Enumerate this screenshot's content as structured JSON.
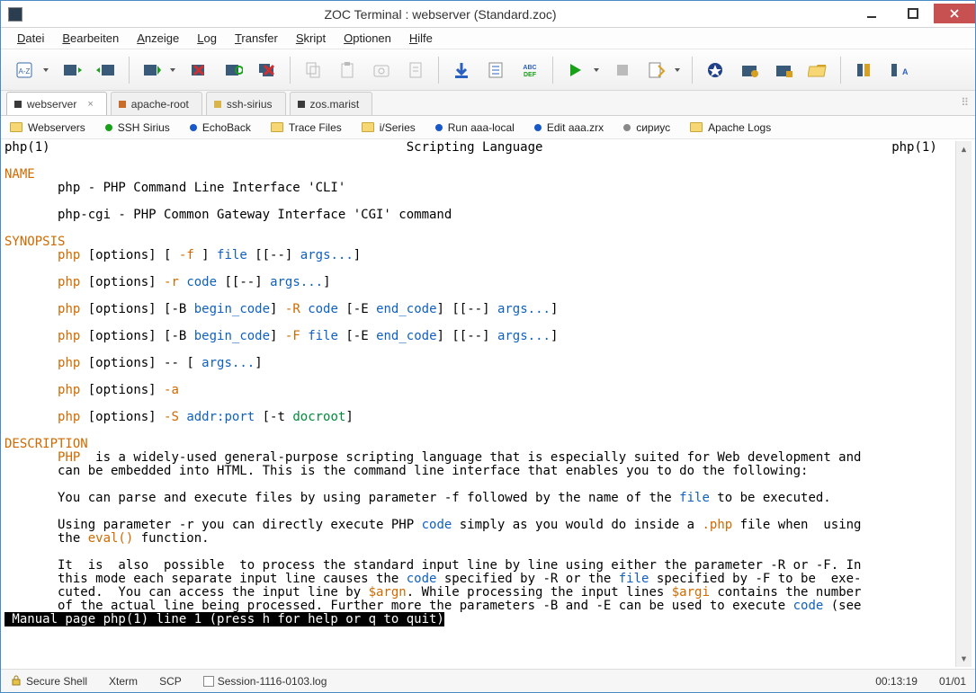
{
  "window": {
    "title": "ZOC Terminal : webserver (Standard.zoc)"
  },
  "menu": [
    "Datei",
    "Bearbeiten",
    "Anzeige",
    "Log",
    "Transfer",
    "Skript",
    "Optionen",
    "Hilfe"
  ],
  "toolbar_groups": [
    {
      "items": [
        {
          "name": "address-book",
          "drop": true
        },
        {
          "name": "session-prev"
        },
        {
          "name": "session-next"
        }
      ]
    },
    {
      "items": [
        {
          "name": "connect",
          "drop": true
        },
        {
          "name": "disconnect"
        },
        {
          "name": "reconnect"
        },
        {
          "name": "disconnect-all"
        }
      ]
    },
    {
      "items": [
        {
          "name": "copy",
          "dim": true
        },
        {
          "name": "paste",
          "dim": true
        },
        {
          "name": "capture",
          "dim": true
        },
        {
          "name": "clipboard",
          "dim": true
        }
      ]
    },
    {
      "items": [
        {
          "name": "download"
        },
        {
          "name": "notes"
        },
        {
          "name": "abc-def"
        }
      ]
    },
    {
      "items": [
        {
          "name": "run",
          "drop": true
        },
        {
          "name": "stop",
          "dim": true
        },
        {
          "name": "script-edit",
          "drop": true
        }
      ]
    },
    {
      "items": [
        {
          "name": "tool-a"
        },
        {
          "name": "tool-b"
        },
        {
          "name": "tool-c"
        },
        {
          "name": "folder-open"
        }
      ]
    },
    {
      "items": [
        {
          "name": "tool-d"
        },
        {
          "name": "tool-ab"
        }
      ]
    }
  ],
  "tabs": [
    {
      "label": "webserver",
      "color": "#3a3a3a",
      "active": true,
      "closable": true
    },
    {
      "label": "apache-root",
      "color": "#c96b2a"
    },
    {
      "label": "ssh-sirius",
      "color": "#d8b44a"
    },
    {
      "label": "zos.marist",
      "color": "#3a3a3a"
    }
  ],
  "favs": [
    {
      "type": "folder",
      "label": "Webservers"
    },
    {
      "type": "dot",
      "color": "#18a018",
      "label": "SSH Sirius"
    },
    {
      "type": "dot",
      "color": "#1858c8",
      "label": "EchoBack"
    },
    {
      "type": "folder",
      "label": "Trace Files"
    },
    {
      "type": "folder",
      "label": "i/Series"
    },
    {
      "type": "dot",
      "color": "#1858c8",
      "label": "Run aaa-local"
    },
    {
      "type": "dot",
      "color": "#1858c8",
      "label": "Edit aaa.zrx"
    },
    {
      "type": "dot",
      "color": "#888",
      "label": "сириус"
    },
    {
      "type": "folder",
      "label": "Apache Logs",
      "fc": "#f7d774"
    }
  ],
  "term": {
    "hdr_l": "php(1)",
    "hdr_c": "Scripting Language",
    "hdr_r": "php(1)",
    "s_name": "NAME",
    "name1": "       php - PHP Command Line Interface 'CLI'",
    "name2": "       php-cgi - PHP Common Gateway Interface 'CGI' command",
    "s_syn": "SYNOPSIS",
    "syn1_a": "php",
    "syn1_b": " [options] [ ",
    "syn1_c": "-f",
    "syn1_d": " ] ",
    "syn1_e": "file",
    "syn1_f": " [[--] ",
    "syn1_g": "args...",
    "syn1_h": "]",
    "syn2_a": "php",
    "syn2_b": " [options] ",
    "syn2_c": "-r",
    "syn2_d": " ",
    "syn2_e": "code",
    "syn2_f": " [[--] ",
    "syn2_g": "args...",
    "syn2_h": "]",
    "syn3_a": "php",
    "syn3_b": " [options] [-B ",
    "syn3_c": "begin_code",
    "syn3_d": "] ",
    "syn3_e": "-R",
    "syn3_f": " ",
    "syn3_g": "code",
    "syn3_h": " [-E ",
    "syn3_i": "end_code",
    "syn3_j": "] [[--] ",
    "syn3_k": "args...",
    "syn3_l": "]",
    "syn4_a": "php",
    "syn4_b": " [options] [-B ",
    "syn4_c": "begin_code",
    "syn4_d": "] ",
    "syn4_e": "-F",
    "syn4_f": " ",
    "syn4_g": "file",
    "syn4_h": " [-E ",
    "syn4_i": "end_code",
    "syn4_j": "] [[--] ",
    "syn4_k": "args...",
    "syn4_l": "]",
    "syn5_a": "php",
    "syn5_b": " [options] -- [ ",
    "syn5_c": "args...",
    "syn5_d": "]",
    "syn6_a": "php",
    "syn6_b": " [options] ",
    "syn6_c": "-a",
    "syn7_a": "php",
    "syn7_b": " [options] ",
    "syn7_c": "-S",
    "syn7_d": " ",
    "syn7_e": "addr:port",
    "syn7_f": " [-t ",
    "syn7_g": "docroot",
    "syn7_h": "]",
    "s_desc": "DESCRIPTION",
    "d1_a": "PHP",
    "d1_b": "  is a widely-used general-purpose scripting language that is especially suited for Web development and",
    "d1_c": "       can be embedded into HTML. This is the command line interface that enables you to do the following:",
    "d2_a": "       You can parse and execute files by using parameter -f followed by the name of the ",
    "d2_b": "file",
    "d2_c": " to be executed.",
    "d3_a": "       Using parameter -r you can directly execute PHP ",
    "d3_b": "code",
    "d3_c": " simply as you would do inside a ",
    "d3_d": ".php",
    "d3_e": " file when  using",
    "d3_f": "       the ",
    "d3_g": "eval()",
    "d3_h": " function.",
    "d4_a": "       It  is  also  possible  to process the standard input line by line using either the parameter -R or -F. In",
    "d4_b": "       this mode each separate input line causes the ",
    "d4_c": "code",
    "d4_d": " specified by -R or the ",
    "d4_e": "file",
    "d4_f": " specified by -F to be  exe‐",
    "d4_g": "       cuted.  You can access the input line by ",
    "d4_h": "$argn",
    "d4_i": ". While processing the input lines ",
    "d4_j": "$argi",
    "d4_k": " contains the number",
    "d4_l": "       of the actual line being processed. Further more the parameters -B and -E can be used to execute ",
    "d4_m": "code",
    "d4_n": " (see",
    "footer": " Manual page php(1) line 1 (press h for help or q to quit)"
  },
  "status": {
    "conn": "Secure Shell",
    "emu": "Xterm",
    "proto": "SCP",
    "log": "Session-1116-0103.log",
    "time": "00:13:19",
    "pos": "01/01"
  }
}
